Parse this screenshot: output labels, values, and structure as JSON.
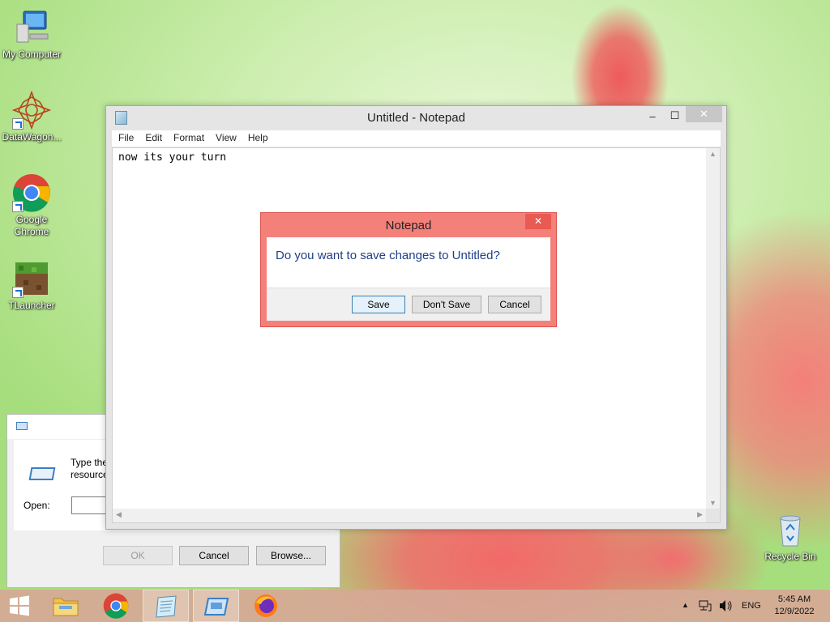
{
  "desktop": {
    "icons": [
      {
        "label": "My Computer"
      },
      {
        "label": "DataWagon..."
      },
      {
        "label": "Google Chrome"
      },
      {
        "label": "TLauncher"
      },
      {
        "label": "Recycle Bin"
      }
    ]
  },
  "run_dialog": {
    "description": "Type the r\nresource,",
    "open_label": "Open:",
    "open_value": "",
    "ok_label": "OK",
    "cancel_label": "Cancel",
    "browse_label": "Browse..."
  },
  "notepad": {
    "title": "Untitled - Notepad",
    "minimize": "‒",
    "maximize": "☐",
    "close": "✕",
    "menu": [
      "File",
      "Edit",
      "Format",
      "View",
      "Help"
    ],
    "content": "now its your turn"
  },
  "save_dialog": {
    "title": "Notepad",
    "close": "✕",
    "message": "Do you want to save changes to Untitled?",
    "save_label": "Save",
    "dont_save_label": "Don't Save",
    "cancel_label": "Cancel"
  },
  "taskbar": {
    "items": [
      "start-icon",
      "file-explorer-icon",
      "chrome-icon",
      "notepad-icon",
      "run-icon",
      "firefox-icon"
    ],
    "tray": {
      "chevron": "▲",
      "language": "ENG",
      "time": "5:45 AM",
      "date": "12/9/2022"
    }
  },
  "colors": {
    "dialog_accent": "#f4807a",
    "dialog_close": "#e85a52",
    "message_text": "#1f3f86",
    "taskbar": "#d6a896"
  }
}
